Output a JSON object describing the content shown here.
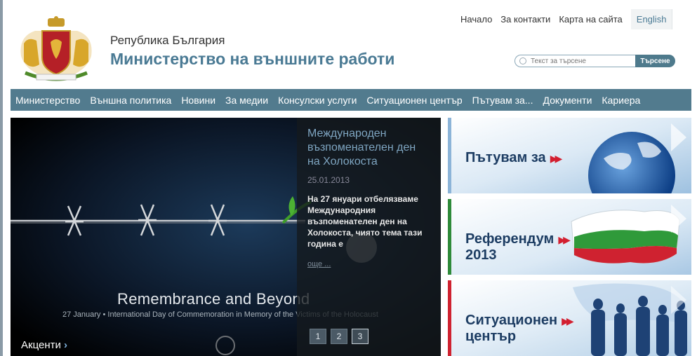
{
  "header": {
    "country": "Република България",
    "ministry": "Министерство на външните работи"
  },
  "topnav": {
    "items": [
      "Начало",
      "За контакти",
      "Карта на сайта"
    ],
    "language": "English"
  },
  "search": {
    "placeholder": "Текст за търсене",
    "button": "Търсене"
  },
  "mainnav": {
    "items": [
      "Министерство",
      "Външна политика",
      "Новини",
      "За медии",
      "Консулски услуги",
      "Ситуационен център",
      "Пътувам за...",
      "Документи",
      "Кариера"
    ]
  },
  "slider": {
    "title": "Международен възпоменателен ден на Холокоста",
    "date": "25.01.2013",
    "text": "На 27 януари отбелязваме Международния възпоменателен ден на Холокоста, чиято тема тази година е",
    "more": "още ...",
    "caption": "Remembrance and Beyond",
    "subcaption": "27 January • International Day of Commemoration in Memory of the Victims of the Holocaust",
    "pages": [
      "1",
      "2",
      "3"
    ],
    "active_page": "3",
    "accents": "Акценти",
    "accents_arrow": "›"
  },
  "banners": {
    "travel": "Пътувам за",
    "referendum_1": "Референдум",
    "referendum_2": "2013",
    "situation_1": "Ситуационен",
    "situation_2": "център",
    "arrow": "▶▶"
  },
  "colors": {
    "accent": "#4a7a94",
    "nav_bg": "#527b8e",
    "banner_text": "#1d3d63",
    "banner_arrow": "#d31f30"
  }
}
